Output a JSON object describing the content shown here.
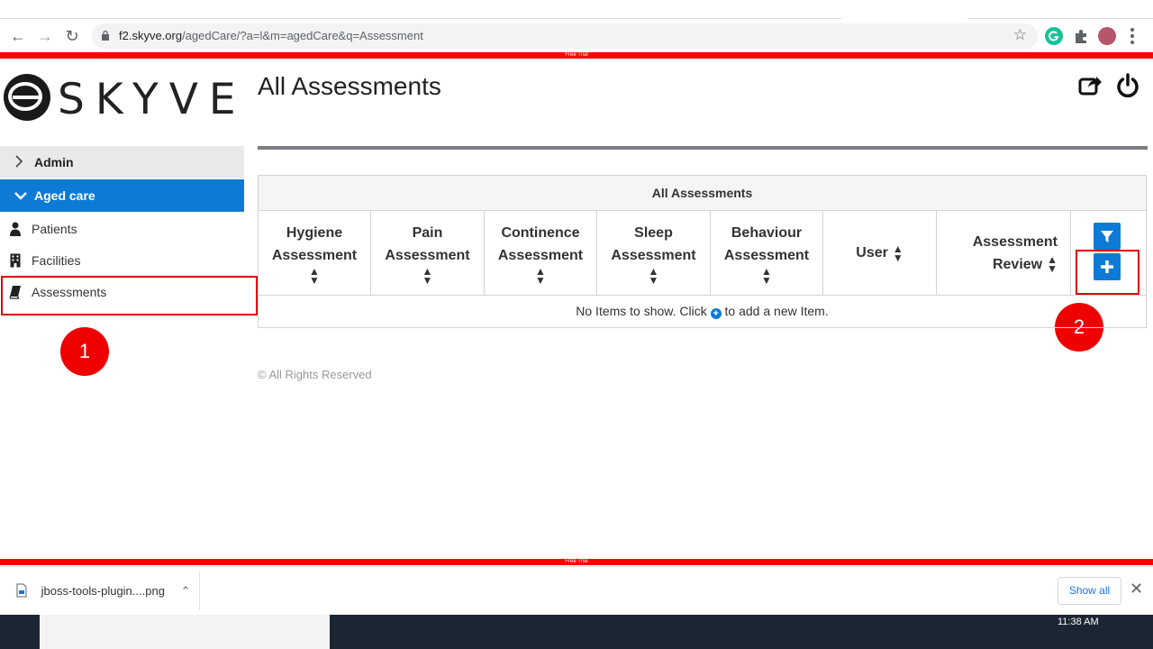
{
  "browser": {
    "url_host": "f2.skyve.org",
    "url_path": "/agedCare/?a=l&m=agedCare&q=Assessment"
  },
  "trial_banner": "Free Trial",
  "app": {
    "logo_text": "SKYVE",
    "page_title": "All Assessments"
  },
  "sidebar": {
    "groups": [
      {
        "label": "Admin",
        "expanded": false
      },
      {
        "label": "Aged care",
        "expanded": true
      }
    ],
    "items": [
      {
        "label": "Patients",
        "icon": "user-icon"
      },
      {
        "label": "Facilities",
        "icon": "building-icon"
      },
      {
        "label": "Assessments",
        "icon": "book-icon"
      }
    ]
  },
  "grid": {
    "caption": "All Assessments",
    "columns": [
      {
        "line1": "Hygiene",
        "line2": "Assessment"
      },
      {
        "line1": "Pain",
        "line2": "Assessment"
      },
      {
        "line1": "Continence",
        "line2": "Assessment"
      },
      {
        "line1": "Sleep",
        "line2": "Assessment"
      },
      {
        "line1": "Behaviour",
        "line2": "Assessment"
      },
      {
        "line1": "User",
        "line2": ""
      },
      {
        "line1": "Assessment",
        "line2": "Review"
      }
    ],
    "empty_before": "No Items to show. Click",
    "empty_after": "to add a new Item."
  },
  "annotations": {
    "one": "1",
    "two": "2"
  },
  "footer": "© All Rights Reserved",
  "downloads": {
    "file_name": "jboss-tools-plugin....png",
    "show_all": "Show all"
  },
  "taskbar": {
    "clock": "11:38 AM"
  },
  "colors": {
    "accent": "#0d7ad6",
    "trial": "#ff0000",
    "annotation": "#ee0000"
  }
}
